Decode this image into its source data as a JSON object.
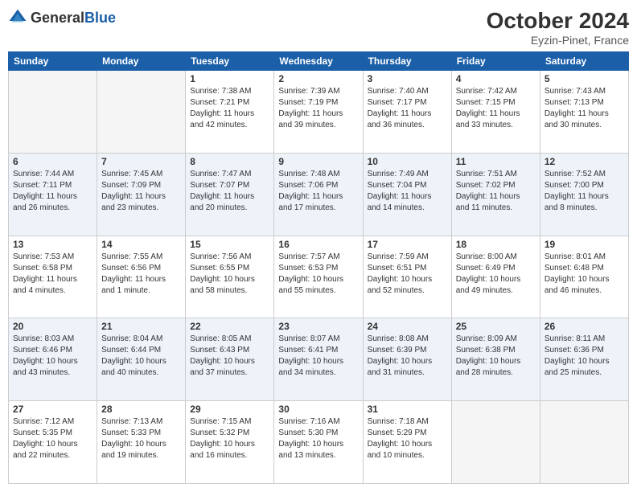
{
  "header": {
    "logo_general": "General",
    "logo_blue": "Blue",
    "month_title": "October 2024",
    "location": "Eyzin-Pinet, France"
  },
  "days_of_week": [
    "Sunday",
    "Monday",
    "Tuesday",
    "Wednesday",
    "Thursday",
    "Friday",
    "Saturday"
  ],
  "weeks": [
    [
      {
        "day": "",
        "info": ""
      },
      {
        "day": "",
        "info": ""
      },
      {
        "day": "1",
        "info": "Sunrise: 7:38 AM\nSunset: 7:21 PM\nDaylight: 11 hours and 42 minutes."
      },
      {
        "day": "2",
        "info": "Sunrise: 7:39 AM\nSunset: 7:19 PM\nDaylight: 11 hours and 39 minutes."
      },
      {
        "day": "3",
        "info": "Sunrise: 7:40 AM\nSunset: 7:17 PM\nDaylight: 11 hours and 36 minutes."
      },
      {
        "day": "4",
        "info": "Sunrise: 7:42 AM\nSunset: 7:15 PM\nDaylight: 11 hours and 33 minutes."
      },
      {
        "day": "5",
        "info": "Sunrise: 7:43 AM\nSunset: 7:13 PM\nDaylight: 11 hours and 30 minutes."
      }
    ],
    [
      {
        "day": "6",
        "info": "Sunrise: 7:44 AM\nSunset: 7:11 PM\nDaylight: 11 hours and 26 minutes."
      },
      {
        "day": "7",
        "info": "Sunrise: 7:45 AM\nSunset: 7:09 PM\nDaylight: 11 hours and 23 minutes."
      },
      {
        "day": "8",
        "info": "Sunrise: 7:47 AM\nSunset: 7:07 PM\nDaylight: 11 hours and 20 minutes."
      },
      {
        "day": "9",
        "info": "Sunrise: 7:48 AM\nSunset: 7:06 PM\nDaylight: 11 hours and 17 minutes."
      },
      {
        "day": "10",
        "info": "Sunrise: 7:49 AM\nSunset: 7:04 PM\nDaylight: 11 hours and 14 minutes."
      },
      {
        "day": "11",
        "info": "Sunrise: 7:51 AM\nSunset: 7:02 PM\nDaylight: 11 hours and 11 minutes."
      },
      {
        "day": "12",
        "info": "Sunrise: 7:52 AM\nSunset: 7:00 PM\nDaylight: 11 hours and 8 minutes."
      }
    ],
    [
      {
        "day": "13",
        "info": "Sunrise: 7:53 AM\nSunset: 6:58 PM\nDaylight: 11 hours and 4 minutes."
      },
      {
        "day": "14",
        "info": "Sunrise: 7:55 AM\nSunset: 6:56 PM\nDaylight: 11 hours and 1 minute."
      },
      {
        "day": "15",
        "info": "Sunrise: 7:56 AM\nSunset: 6:55 PM\nDaylight: 10 hours and 58 minutes."
      },
      {
        "day": "16",
        "info": "Sunrise: 7:57 AM\nSunset: 6:53 PM\nDaylight: 10 hours and 55 minutes."
      },
      {
        "day": "17",
        "info": "Sunrise: 7:59 AM\nSunset: 6:51 PM\nDaylight: 10 hours and 52 minutes."
      },
      {
        "day": "18",
        "info": "Sunrise: 8:00 AM\nSunset: 6:49 PM\nDaylight: 10 hours and 49 minutes."
      },
      {
        "day": "19",
        "info": "Sunrise: 8:01 AM\nSunset: 6:48 PM\nDaylight: 10 hours and 46 minutes."
      }
    ],
    [
      {
        "day": "20",
        "info": "Sunrise: 8:03 AM\nSunset: 6:46 PM\nDaylight: 10 hours and 43 minutes."
      },
      {
        "day": "21",
        "info": "Sunrise: 8:04 AM\nSunset: 6:44 PM\nDaylight: 10 hours and 40 minutes."
      },
      {
        "day": "22",
        "info": "Sunrise: 8:05 AM\nSunset: 6:43 PM\nDaylight: 10 hours and 37 minutes."
      },
      {
        "day": "23",
        "info": "Sunrise: 8:07 AM\nSunset: 6:41 PM\nDaylight: 10 hours and 34 minutes."
      },
      {
        "day": "24",
        "info": "Sunrise: 8:08 AM\nSunset: 6:39 PM\nDaylight: 10 hours and 31 minutes."
      },
      {
        "day": "25",
        "info": "Sunrise: 8:09 AM\nSunset: 6:38 PM\nDaylight: 10 hours and 28 minutes."
      },
      {
        "day": "26",
        "info": "Sunrise: 8:11 AM\nSunset: 6:36 PM\nDaylight: 10 hours and 25 minutes."
      }
    ],
    [
      {
        "day": "27",
        "info": "Sunrise: 7:12 AM\nSunset: 5:35 PM\nDaylight: 10 hours and 22 minutes."
      },
      {
        "day": "28",
        "info": "Sunrise: 7:13 AM\nSunset: 5:33 PM\nDaylight: 10 hours and 19 minutes."
      },
      {
        "day": "29",
        "info": "Sunrise: 7:15 AM\nSunset: 5:32 PM\nDaylight: 10 hours and 16 minutes."
      },
      {
        "day": "30",
        "info": "Sunrise: 7:16 AM\nSunset: 5:30 PM\nDaylight: 10 hours and 13 minutes."
      },
      {
        "day": "31",
        "info": "Sunrise: 7:18 AM\nSunset: 5:29 PM\nDaylight: 10 hours and 10 minutes."
      },
      {
        "day": "",
        "info": ""
      },
      {
        "day": "",
        "info": ""
      }
    ]
  ]
}
